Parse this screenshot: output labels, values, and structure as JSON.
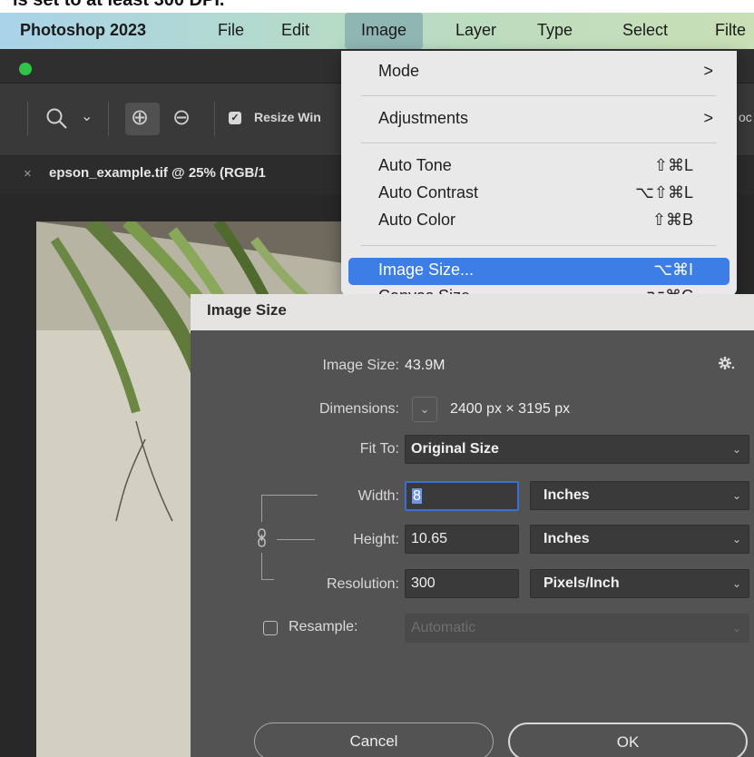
{
  "top_clip": "is set to at least 300 DPI.",
  "menubar": {
    "app": "Photoshop 2023",
    "items": [
      "File",
      "Edit",
      "Image",
      "Layer",
      "Type",
      "Select",
      "Filte"
    ],
    "active": "Image"
  },
  "toolbar": {
    "zoom_icon": "magnifier-icon",
    "chevron": "⌄",
    "zoom_in": "⊕",
    "zoom_out": "⊖",
    "resize_label": "Resize Win",
    "checkbox_mark": "✓",
    "right_clip": "oc"
  },
  "doc_tab": {
    "close": "×",
    "title": "epson_example.tif @ 25% (RGB/1"
  },
  "image_menu": {
    "items": [
      {
        "label": "Mode",
        "arrow": ">"
      },
      {
        "label": "Adjustments",
        "arrow": ">"
      },
      {
        "label": "Auto Tone",
        "shortcut": "⇧⌘L"
      },
      {
        "label": "Auto Contrast",
        "shortcut": "⌥⇧⌘L"
      },
      {
        "label": "Auto Color",
        "shortcut": "⇧⌘B"
      },
      {
        "label": "Image Size...",
        "shortcut": "⌥⌘I"
      },
      {
        "label": "Canvas Size...",
        "shortcut": "⌥⌘C"
      }
    ],
    "highlighted": "Image Size..."
  },
  "dialog": {
    "title": "Image Size",
    "image_size_label": "Image Size:",
    "image_size_value": "43.9M",
    "dimensions_label": "Dimensions:",
    "dimensions_value": "2400 px  ×  3195 px",
    "fit_to_label": "Fit To:",
    "fit_to_value": "Original Size",
    "width_label": "Width:",
    "width_value": "8",
    "width_unit": "Inches",
    "height_label": "Height:",
    "height_value": "10.65",
    "height_unit": "Inches",
    "resolution_label": "Resolution:",
    "resolution_value": "300",
    "resolution_unit": "Pixels/Inch",
    "resample_label": "Resample:",
    "resample_value": "Automatic",
    "resample_checked": false,
    "cancel": "Cancel",
    "ok": "OK",
    "gear_icon": "gear-icon"
  },
  "colors": {
    "menu_highlight": "#3d7de6",
    "dialog_bg": "#535353",
    "traffic_green": "#2fc44a"
  }
}
